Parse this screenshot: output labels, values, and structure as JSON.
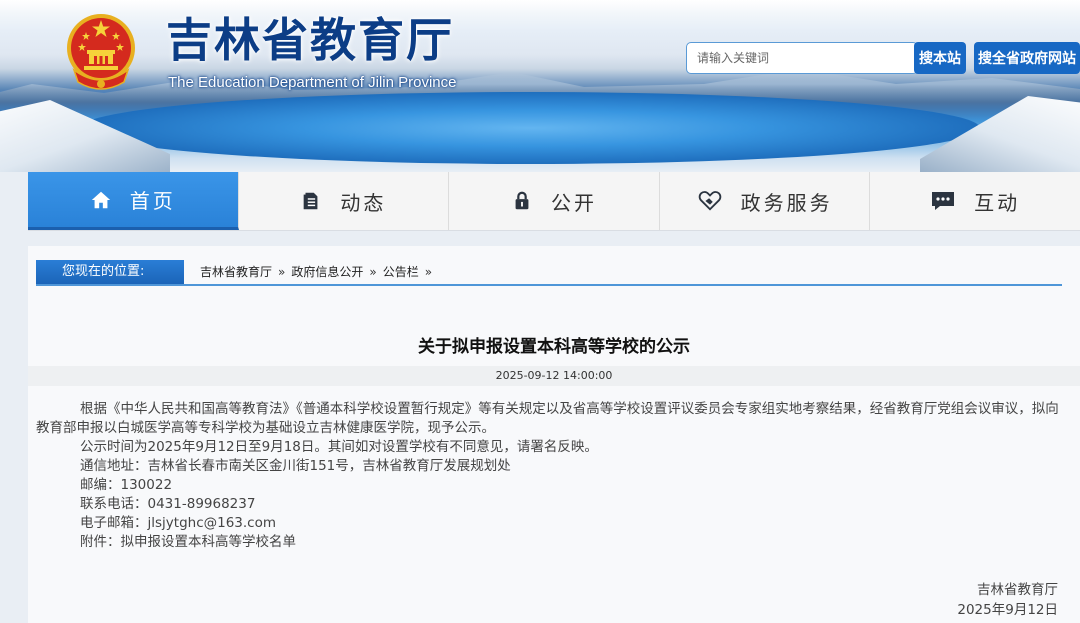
{
  "header": {
    "title": "吉林省教育厅",
    "subtitle": "The Education Department of Jilin Province",
    "emblem": "national-emblem",
    "search": {
      "placeholder": "请输入关键词",
      "site_button": "搜本站",
      "all_button": "搜全省政府网站"
    }
  },
  "nav": {
    "items": [
      {
        "label": "首页",
        "icon": "home-icon",
        "active": true
      },
      {
        "label": "动态",
        "icon": "document-icon",
        "active": false
      },
      {
        "label": "公开",
        "icon": "lock-icon",
        "active": false
      },
      {
        "label": "政务服务",
        "icon": "handshake-icon",
        "active": false
      },
      {
        "label": "互动",
        "icon": "chat-icon",
        "active": false
      }
    ]
  },
  "breadcrumb": {
    "label": "您现在的位置:",
    "items": [
      "吉林省教育厅",
      "政府信息公开",
      "公告栏"
    ],
    "separator": "»"
  },
  "article": {
    "title": "关于拟申报设置本科高等学校的公示",
    "date": "2025-09-12 14:00:00",
    "paragraph1": "根据《中华人民共和国高等教育法》《普通本科学校设置暂行规定》等有关规定以及省高等学校设置评议委员会专家组实地考察结果，经省教育厅党组会议审议，拟向教育部申报以白城医学高等专科学校为基础设立吉林健康医学院，现予公示。",
    "paragraph2": "公示时间为2025年9月12日至9月18日。其间如对设置学校有不同意见，请署名反映。",
    "address": "通信地址：吉林省长春市南关区金川街151号，吉林省教育厅发展规划处",
    "postcode": "邮编：130022",
    "phone": "联系电话：0431-89968237",
    "email": "电子邮箱：jlsjytghc@163.com",
    "attachment": "附件：拟申报设置本科高等学校名单",
    "signature": "吉林省教育厅",
    "signature_date": "2025年9月12日"
  },
  "colors": {
    "brand_blue": "#0c3d86",
    "nav_active": "#2a82d8",
    "button": "#1768c4"
  }
}
